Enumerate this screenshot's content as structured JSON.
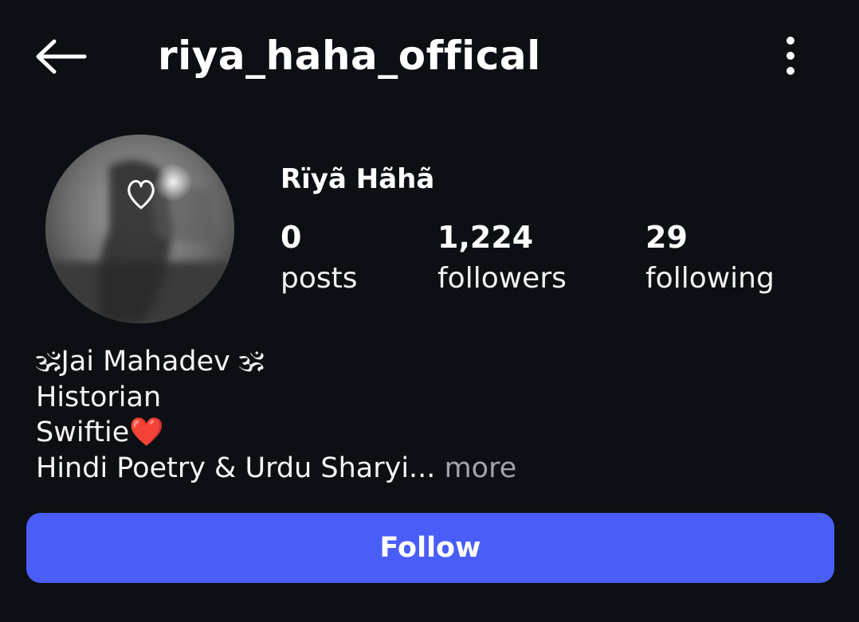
{
  "header": {
    "username": "riya_haha_offical",
    "back_icon": "arrow-left-icon",
    "menu_icon": "more-vertical-icon"
  },
  "profile": {
    "display_name": "Rïyã Hãhã",
    "avatar_icon": "heart-outline-icon",
    "stats": [
      {
        "value": "0",
        "label": "posts"
      },
      {
        "value": "1,224",
        "label": "followers"
      },
      {
        "value": "29",
        "label": "following"
      }
    ]
  },
  "bio": {
    "lines": [
      "🕉Jai Mahadev 🕉",
      "Historian",
      "Swiftie❤️",
      "Hindi Poetry & Urdu Sharyi..."
    ],
    "more_label": " more"
  },
  "actions": {
    "follow_label": "Follow"
  },
  "colors": {
    "background": "#0c0f14",
    "accent": "#4a5ef7",
    "muted_text": "#a0a4ab"
  }
}
